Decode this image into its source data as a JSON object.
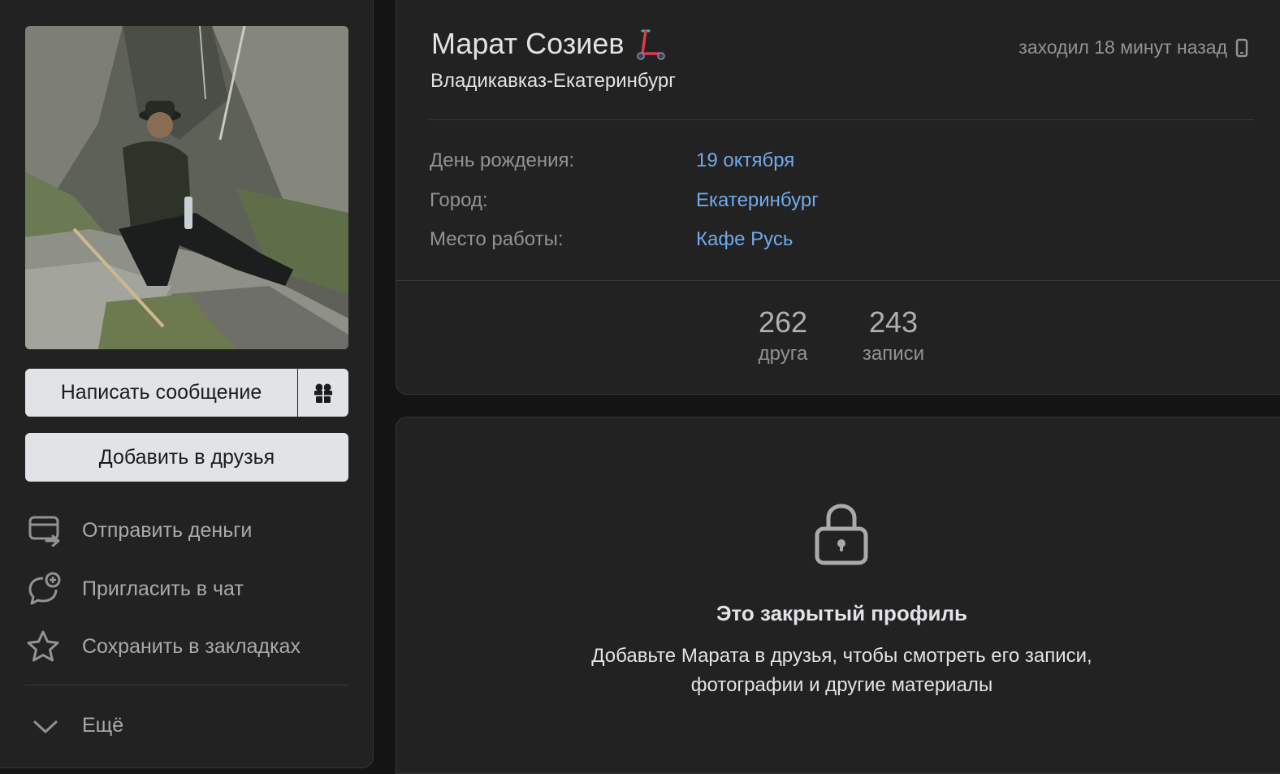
{
  "profile": {
    "name": "Марат Созиев",
    "status": "Владикавказ-Екатеринбург",
    "last_seen": "заходил 18 минут назад",
    "info": [
      {
        "key": "День рождения:",
        "value": "19 октября"
      },
      {
        "key": "Город:",
        "value": "Екатеринбург"
      },
      {
        "key": "Место работы:",
        "value": "Кафе Русь"
      }
    ],
    "counters": [
      {
        "num": "262",
        "label": "друга"
      },
      {
        "num": "243",
        "label": "записи"
      }
    ]
  },
  "actions": {
    "message": "Написать сообщение",
    "add_friend": "Добавить в друзья",
    "menu": [
      {
        "label": "Отправить деньги",
        "icon": "money-transfer-icon"
      },
      {
        "label": "Пригласить в чат",
        "icon": "chat-add-icon"
      },
      {
        "label": "Сохранить в закладках",
        "icon": "star-icon"
      }
    ],
    "more": "Ещё"
  },
  "closed": {
    "title": "Это закрытый профиль",
    "line1": "Добавьте Марата в друзья, чтобы смотреть его записи,",
    "line2": "фотографии и другие материалы"
  },
  "colors": {
    "background": "#141414",
    "card": "#222222",
    "link": "#71aaeb",
    "button": "#e1e3e6",
    "muted": "#939393"
  }
}
